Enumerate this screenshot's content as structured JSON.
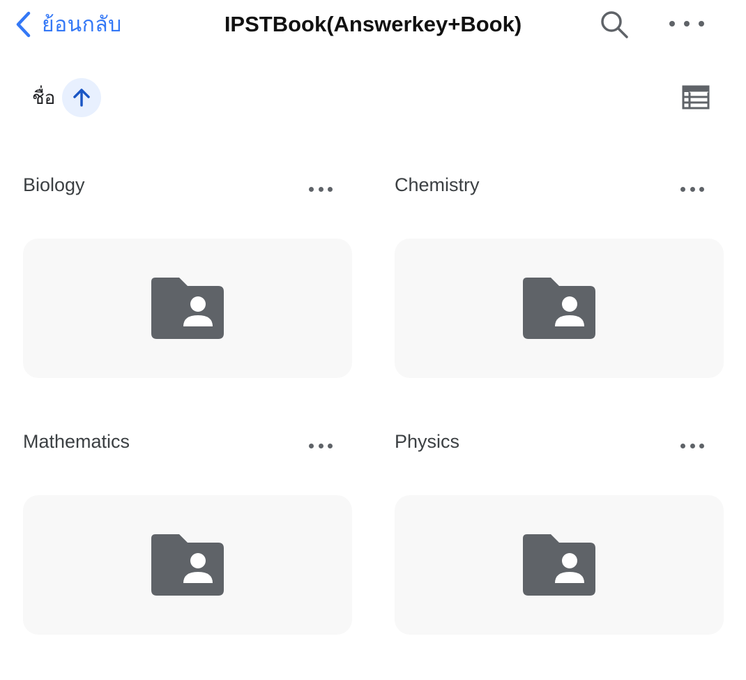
{
  "nav": {
    "back_label": "ย้อนกลับ",
    "title": "IPSTBook(Answerkey+Book)",
    "search_icon": "search-icon",
    "more_icon": "more-horizontal-icon"
  },
  "sort": {
    "label": "ชื่อ",
    "direction_icon": "arrow-up-icon",
    "view_icon": "list-view-icon"
  },
  "folders": [
    {
      "name": "Biology",
      "icon": "shared-folder-icon"
    },
    {
      "name": "Chemistry",
      "icon": "shared-folder-icon"
    },
    {
      "name": "Mathematics",
      "icon": "shared-folder-icon"
    },
    {
      "name": "Physics",
      "icon": "shared-folder-icon"
    }
  ],
  "colors": {
    "accent": "#3478f6",
    "sort_bg": "#e8f0fe",
    "sort_arrow": "#1a56c4",
    "icon_gray": "#5f6368",
    "card_bg": "#f8f8f8"
  }
}
